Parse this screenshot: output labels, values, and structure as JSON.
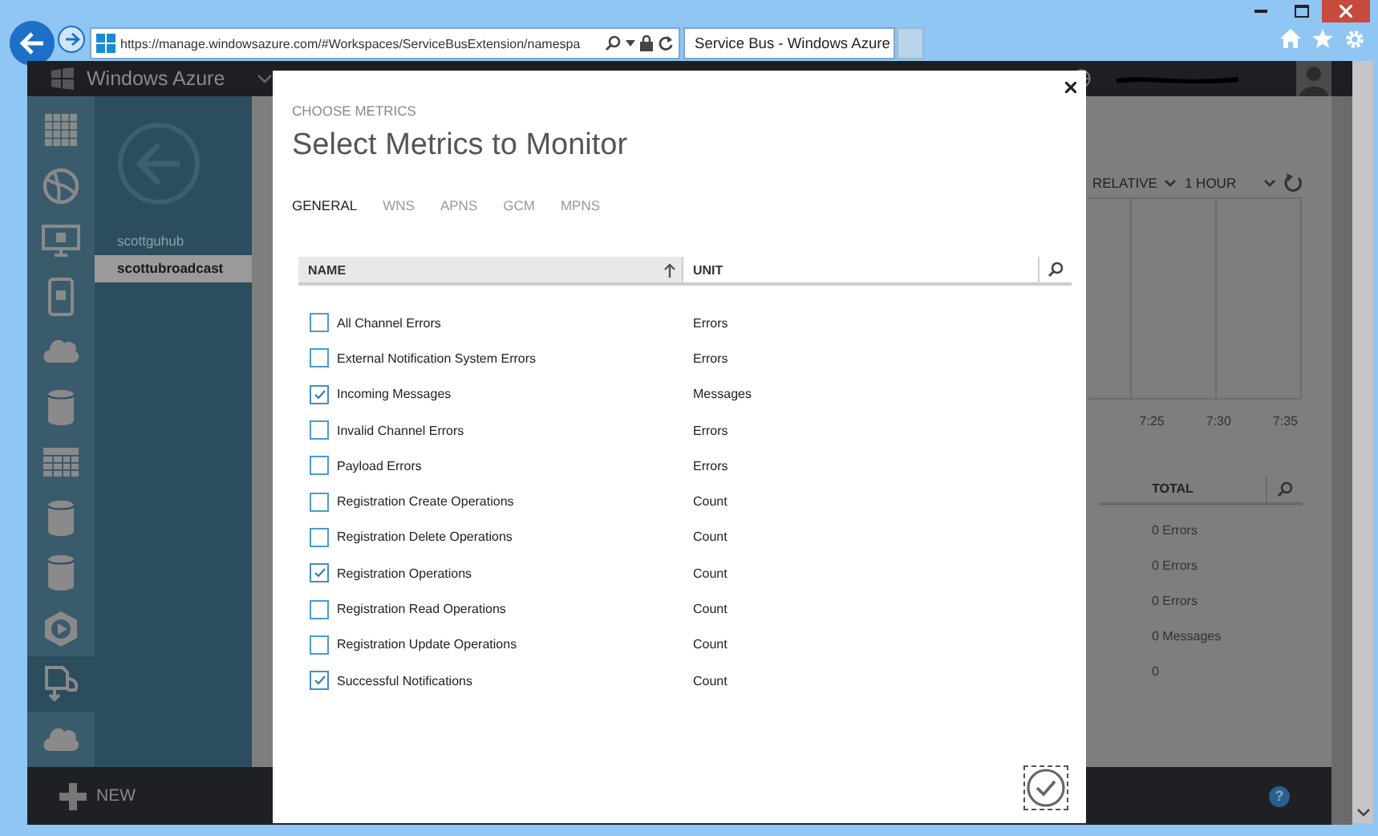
{
  "browser": {
    "address": "https://manage.windowsazure.com/#Workspaces/ServiceBusExtension/namespa",
    "tab_title": "Service Bus - Windows Azure"
  },
  "portal": {
    "brand": "Windows Azure",
    "rail": [
      {
        "selected": false
      },
      {
        "selected": false
      },
      {
        "selected": false
      },
      {
        "selected": false
      },
      {
        "selected": false
      },
      {
        "selected": false
      },
      {
        "selected": false
      },
      {
        "selected": false
      },
      {
        "selected": false
      },
      {
        "selected": false
      },
      {
        "selected": true
      },
      {
        "selected": false
      }
    ],
    "nav_items": [
      {
        "label": "scottguhub",
        "selected": false
      },
      {
        "label": "scottubroadcast",
        "selected": true
      }
    ],
    "new_label": "NEW",
    "help": "?"
  },
  "background": {
    "range": "RELATIVE",
    "period": "1 HOUR",
    "ticks": [
      "7:25",
      "7:30",
      "7:35"
    ],
    "total_header": "TOTAL",
    "totals": [
      "0 Errors",
      "0 Errors",
      "0 Errors",
      "0 Messages",
      "0"
    ]
  },
  "modal": {
    "eyebrow": "CHOOSE METRICS",
    "title": "Select Metrics to Monitor",
    "tabs": [
      {
        "label": "GENERAL",
        "selected": true
      },
      {
        "label": "WNS",
        "selected": false
      },
      {
        "label": "APNS",
        "selected": false
      },
      {
        "label": "GCM",
        "selected": false
      },
      {
        "label": "MPNS",
        "selected": false
      }
    ],
    "columns": [
      "NAME",
      "UNIT"
    ],
    "rows": [
      {
        "name": "All Channel Errors",
        "unit": "Errors",
        "checked": false
      },
      {
        "name": "External Notification System Errors",
        "unit": "Errors",
        "checked": false
      },
      {
        "name": "Incoming Messages",
        "unit": "Messages",
        "checked": true
      },
      {
        "name": "Invalid Channel Errors",
        "unit": "Errors",
        "checked": false
      },
      {
        "name": "Payload Errors",
        "unit": "Errors",
        "checked": false
      },
      {
        "name": "Registration Create Operations",
        "unit": "Count",
        "checked": false
      },
      {
        "name": "Registration Delete Operations",
        "unit": "Count",
        "checked": false
      },
      {
        "name": "Registration Operations",
        "unit": "Count",
        "checked": true
      },
      {
        "name": "Registration Read Operations",
        "unit": "Count",
        "checked": false
      },
      {
        "name": "Registration Update Operations",
        "unit": "Count",
        "checked": false
      },
      {
        "name": "Successful Notifications",
        "unit": "Count",
        "checked": true
      }
    ]
  }
}
